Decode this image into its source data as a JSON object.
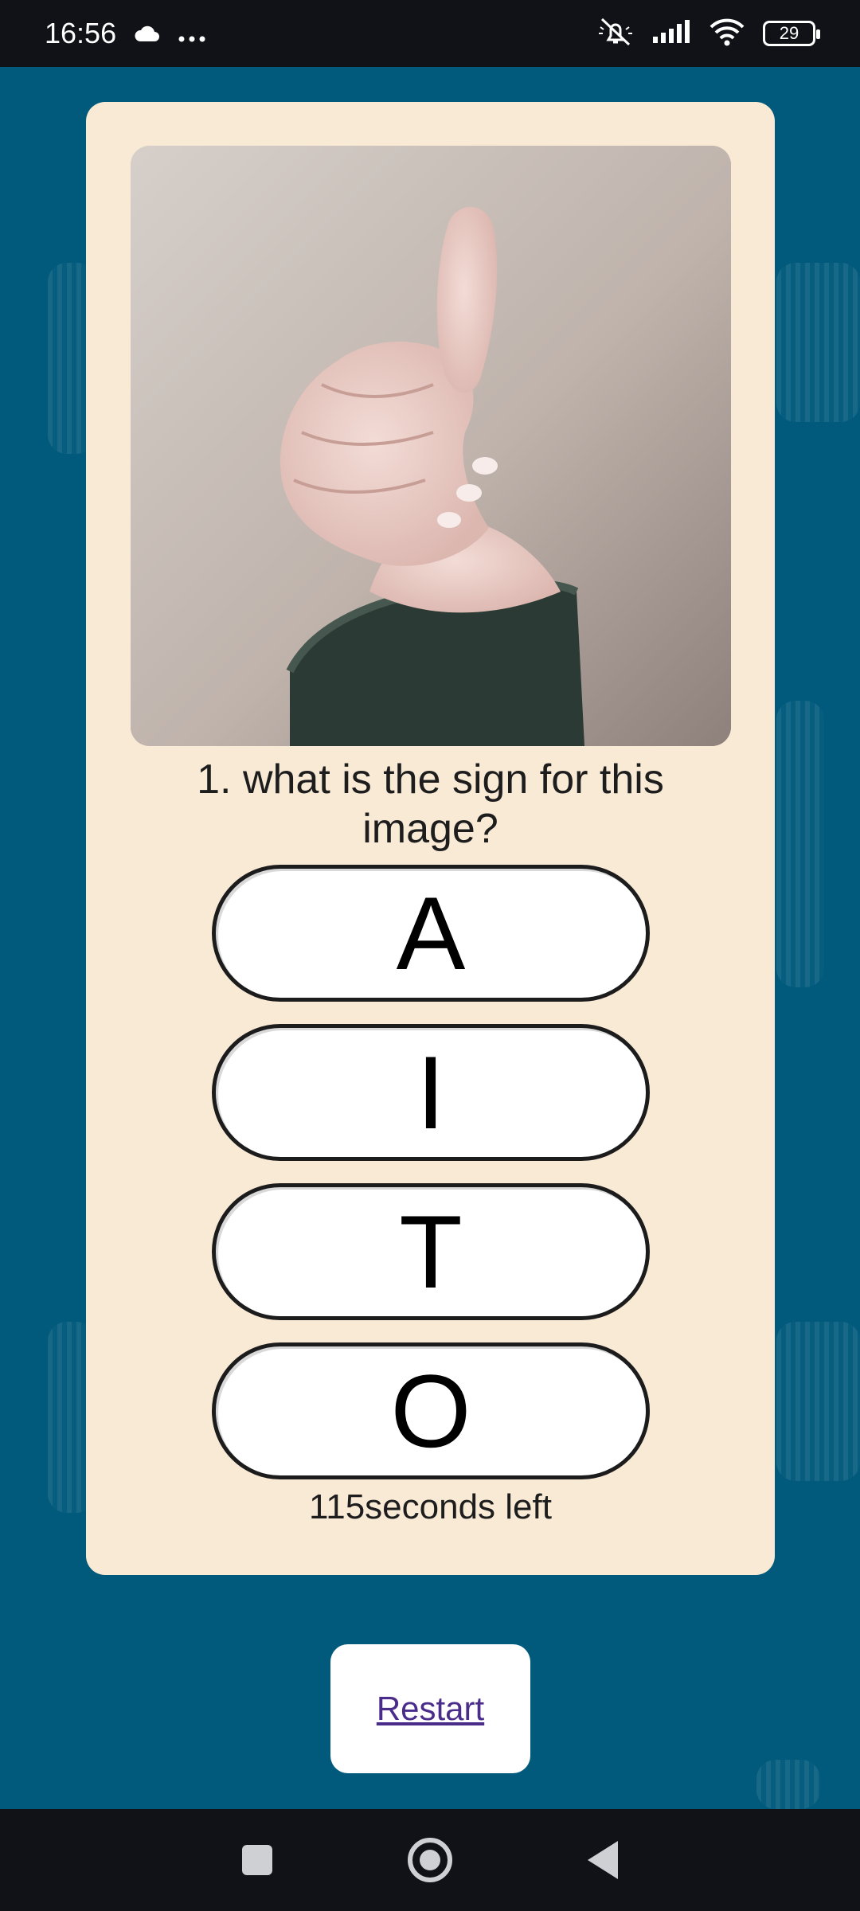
{
  "status_bar": {
    "time": "16:56",
    "icons": [
      "cloud-icon",
      "more-dots-icon",
      "mute-icon",
      "signal-icon",
      "wifi-icon"
    ],
    "battery": "29"
  },
  "quiz": {
    "question": "1. what is the sign for this image?",
    "answers": [
      "A",
      "I",
      "T",
      "O"
    ],
    "timer": "115seconds left"
  },
  "restart": {
    "label": "Restart"
  },
  "colors": {
    "background": "#015a7c",
    "card": "#f9ead6",
    "link": "#4a2d8a"
  }
}
